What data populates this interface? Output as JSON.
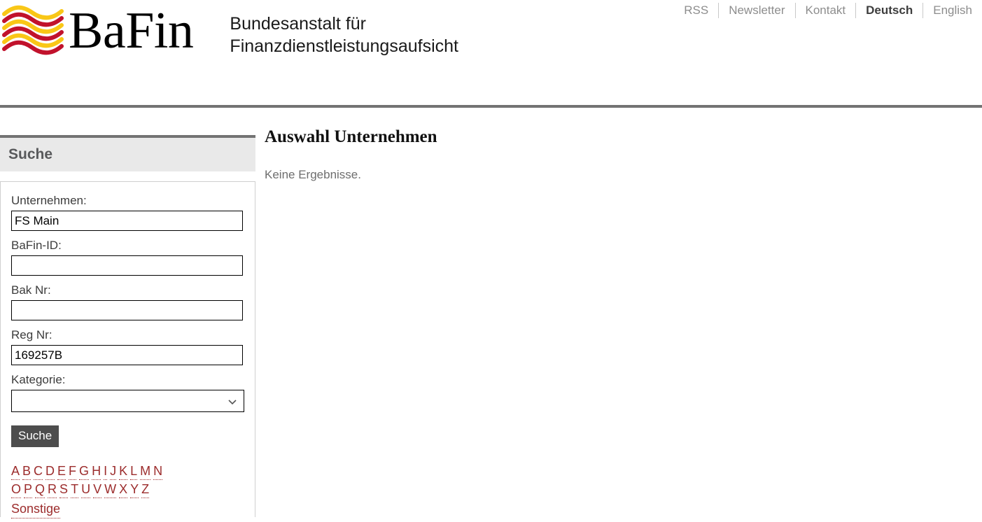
{
  "topnav": {
    "items": [
      {
        "label": "RSS",
        "active": false
      },
      {
        "label": "Newsletter",
        "active": false
      },
      {
        "label": "Kontakt",
        "active": false
      },
      {
        "label": "Deutsch",
        "active": true
      },
      {
        "label": "English",
        "active": false
      }
    ]
  },
  "header": {
    "wordmark": "BaFin",
    "subtitle_line1": "Bundesanstalt für",
    "subtitle_line2": "Finanzdienstleistungsaufsicht",
    "logo_colors": {
      "yellow": "#f9c717",
      "red": "#c1122c"
    }
  },
  "sidebar": {
    "panel_title": "Suche",
    "fields": [
      {
        "label": "Unternehmen:",
        "value": "FS Main",
        "placeholder": ""
      },
      {
        "label": "BaFin-ID:",
        "value": "",
        "placeholder": ""
      },
      {
        "label": "Bak Nr:",
        "value": "",
        "placeholder": ""
      },
      {
        "label": "Reg Nr:",
        "value": "169257B",
        "placeholder": ""
      }
    ],
    "category": {
      "label": "Kategorie:",
      "selected": "",
      "options": [
        ""
      ]
    },
    "search_button": "Suche",
    "alphabet_row1": [
      "A",
      "B",
      "C",
      "D",
      "E",
      "F",
      "G",
      "H",
      "I",
      "J",
      "K",
      "L",
      "M",
      "N"
    ],
    "alphabet_row2": [
      "O",
      "P",
      "Q",
      "R",
      "S",
      "T",
      "U",
      "V",
      "W",
      "X",
      "Y",
      "Z"
    ],
    "other_label": "Sonstige",
    "link_color": "#9c2c2c"
  },
  "content": {
    "title": "Auswahl Unternehmen",
    "message": "Keine Ergebnisse."
  }
}
